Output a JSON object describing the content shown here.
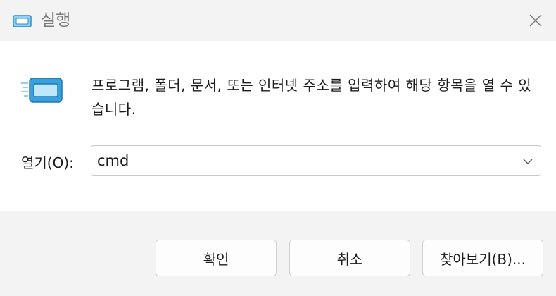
{
  "window": {
    "title": "실행",
    "icon": "run-dialog-icon"
  },
  "content": {
    "description": "프로그램, 폴더, 문서, 또는 인터넷 주소를 입력하여 해당 항목을 열 수 있습니다.",
    "open_label": "열기(O):",
    "open_value": "cmd"
  },
  "buttons": {
    "ok": "확인",
    "cancel": "취소",
    "browse": "찾아보기(B)..."
  },
  "colors": {
    "icon_blue": "#3aa0dc",
    "icon_light": "#8fd2f4"
  }
}
